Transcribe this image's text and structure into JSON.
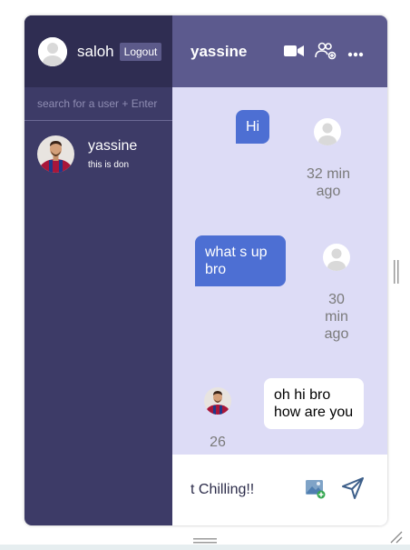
{
  "sidebar": {
    "current_user": "saloh",
    "logout_label": "Logout",
    "search_placeholder": "search for a user + Enter",
    "contacts": [
      {
        "name": "yassine",
        "last_message": "this is don"
      }
    ]
  },
  "chat": {
    "title": "yassine",
    "messages": [
      {
        "text": "Hi",
        "time": "32 min ago",
        "from": "me"
      },
      {
        "text": "what s up bro",
        "time": "30 min ago",
        "from": "me"
      },
      {
        "text": "oh hi bro how are you",
        "time": "26",
        "from": "them"
      }
    ],
    "composer_value": "t Chilling!!"
  },
  "colors": {
    "sidebar_bg": "#3d3b67",
    "header_bg": "#5c5a8e",
    "chat_bg": "#dddcf6",
    "my_bubble": "#4d6fd3"
  }
}
